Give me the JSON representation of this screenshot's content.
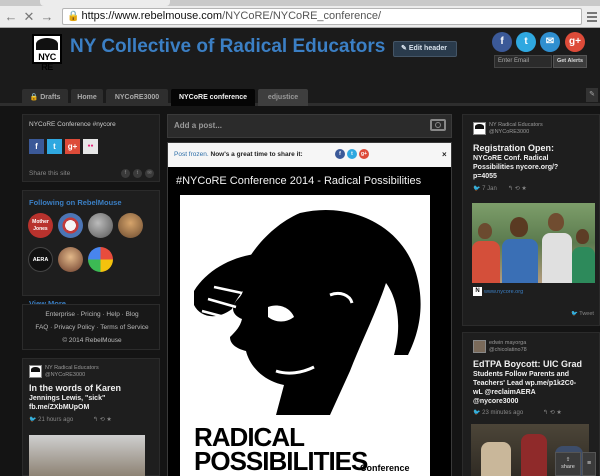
{
  "browser": {
    "url_domain": "https://www.rebelmouse.com",
    "url_path": "/NYCoRE/NYCoRE_conference/"
  },
  "header": {
    "logo_text": "NYC RE",
    "title": "NY Collective of Radical Educators",
    "edit_label": "Edit header",
    "social": [
      "f",
      "t",
      "✉",
      "g+"
    ],
    "email_placeholder": "Enter Email",
    "alerts_label": "Get Alerts"
  },
  "tabs": [
    {
      "label": "Drafts"
    },
    {
      "label": "Home"
    },
    {
      "label": "NYCoRE3000"
    },
    {
      "label": "NYCoRE conference"
    },
    {
      "label": "edjustice"
    }
  ],
  "left": {
    "conf_caption": "NYCoRE Conference #nycore",
    "share_buttons": [
      "f",
      "t",
      "g+",
      "●●"
    ],
    "share_site_label": "Share this site",
    "following_title": "Following on RebelMouse",
    "avatars": [
      "Mother Jones",
      "",
      "",
      "",
      "AERA",
      "",
      ""
    ],
    "view_more": "View More...",
    "footer_row1": "Enterprise  ·  Pricing  ·  Help  ·  Blog",
    "footer_row2": "FAQ  ·  Privacy Policy  ·  Terms of Service",
    "footer_row3": "© 2014 RebelMouse",
    "post": {
      "source_name": "NY Radical Educators",
      "source_handle": "@NYCoRE3000",
      "line1": "In the words of Karen",
      "line2": "Jennings Lewis, \"sick\"",
      "line3": "fb.me/ZXbMUpOM",
      "time": "21 hours ago"
    }
  },
  "center": {
    "add_post_placeholder": "Add a post...",
    "frozen_text_link": "Post frozen.",
    "frozen_text_rest": " Now's a great time to share it:",
    "close": "×",
    "post_title": "#NYCoRE Conference 2014 - Radical Possibilities",
    "hero_line1": "RADICAL",
    "hero_line2": "POSSIBILITIES",
    "hero_sub": "Conference"
  },
  "right": {
    "post1": {
      "source_name": "NY Radical Educators",
      "source_handle": "@NYCoRE3000",
      "line1": "Registration Open:",
      "line2": "NYCoRE Conf. Radical",
      "line3": "Possibilities nycore.org/?",
      "line4": "p=4055",
      "date": "7 Jan",
      "link": "www.nycore.org",
      "tweet": "Tweet"
    },
    "post2": {
      "source_name": "edwin mayorga",
      "source_handle": "@chicolatino78",
      "line1": "EdTPA Boycott: UIC Grad",
      "line2": "Students Follow Parents and",
      "line3": "Teachers' Lead wp.me/p1k2C0-",
      "line4": "wL @reclaimAERA",
      "line5": "@nycore3000",
      "time": "23 minutes ago"
    },
    "share_tab": "share",
    "scroll_tab": "≡"
  },
  "colors": {
    "brand_blue": "#3b7fc4",
    "facebook": "#3b5998",
    "twitter": "#2fa8e0",
    "email": "#2f8fd0",
    "google": "#dd4b39"
  }
}
